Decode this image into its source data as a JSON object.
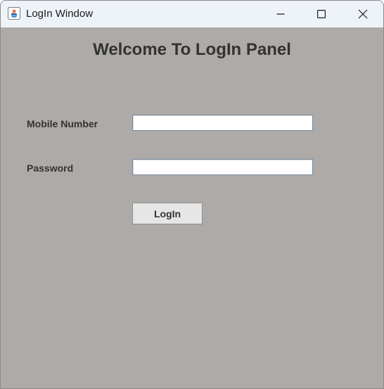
{
  "window": {
    "title": "LogIn Window",
    "controls": {
      "minimize": "minimize-icon",
      "maximize": "maximize-icon",
      "close": "close-icon"
    }
  },
  "panel": {
    "heading": "Welcome To LogIn Panel",
    "mobile_label": "Mobile Number",
    "mobile_value": "",
    "password_label": "Password",
    "password_value": "",
    "login_button": "LogIn"
  },
  "colors": {
    "background": "#adaaa7",
    "titlebar": "#eef3fa",
    "text": "#333333"
  }
}
